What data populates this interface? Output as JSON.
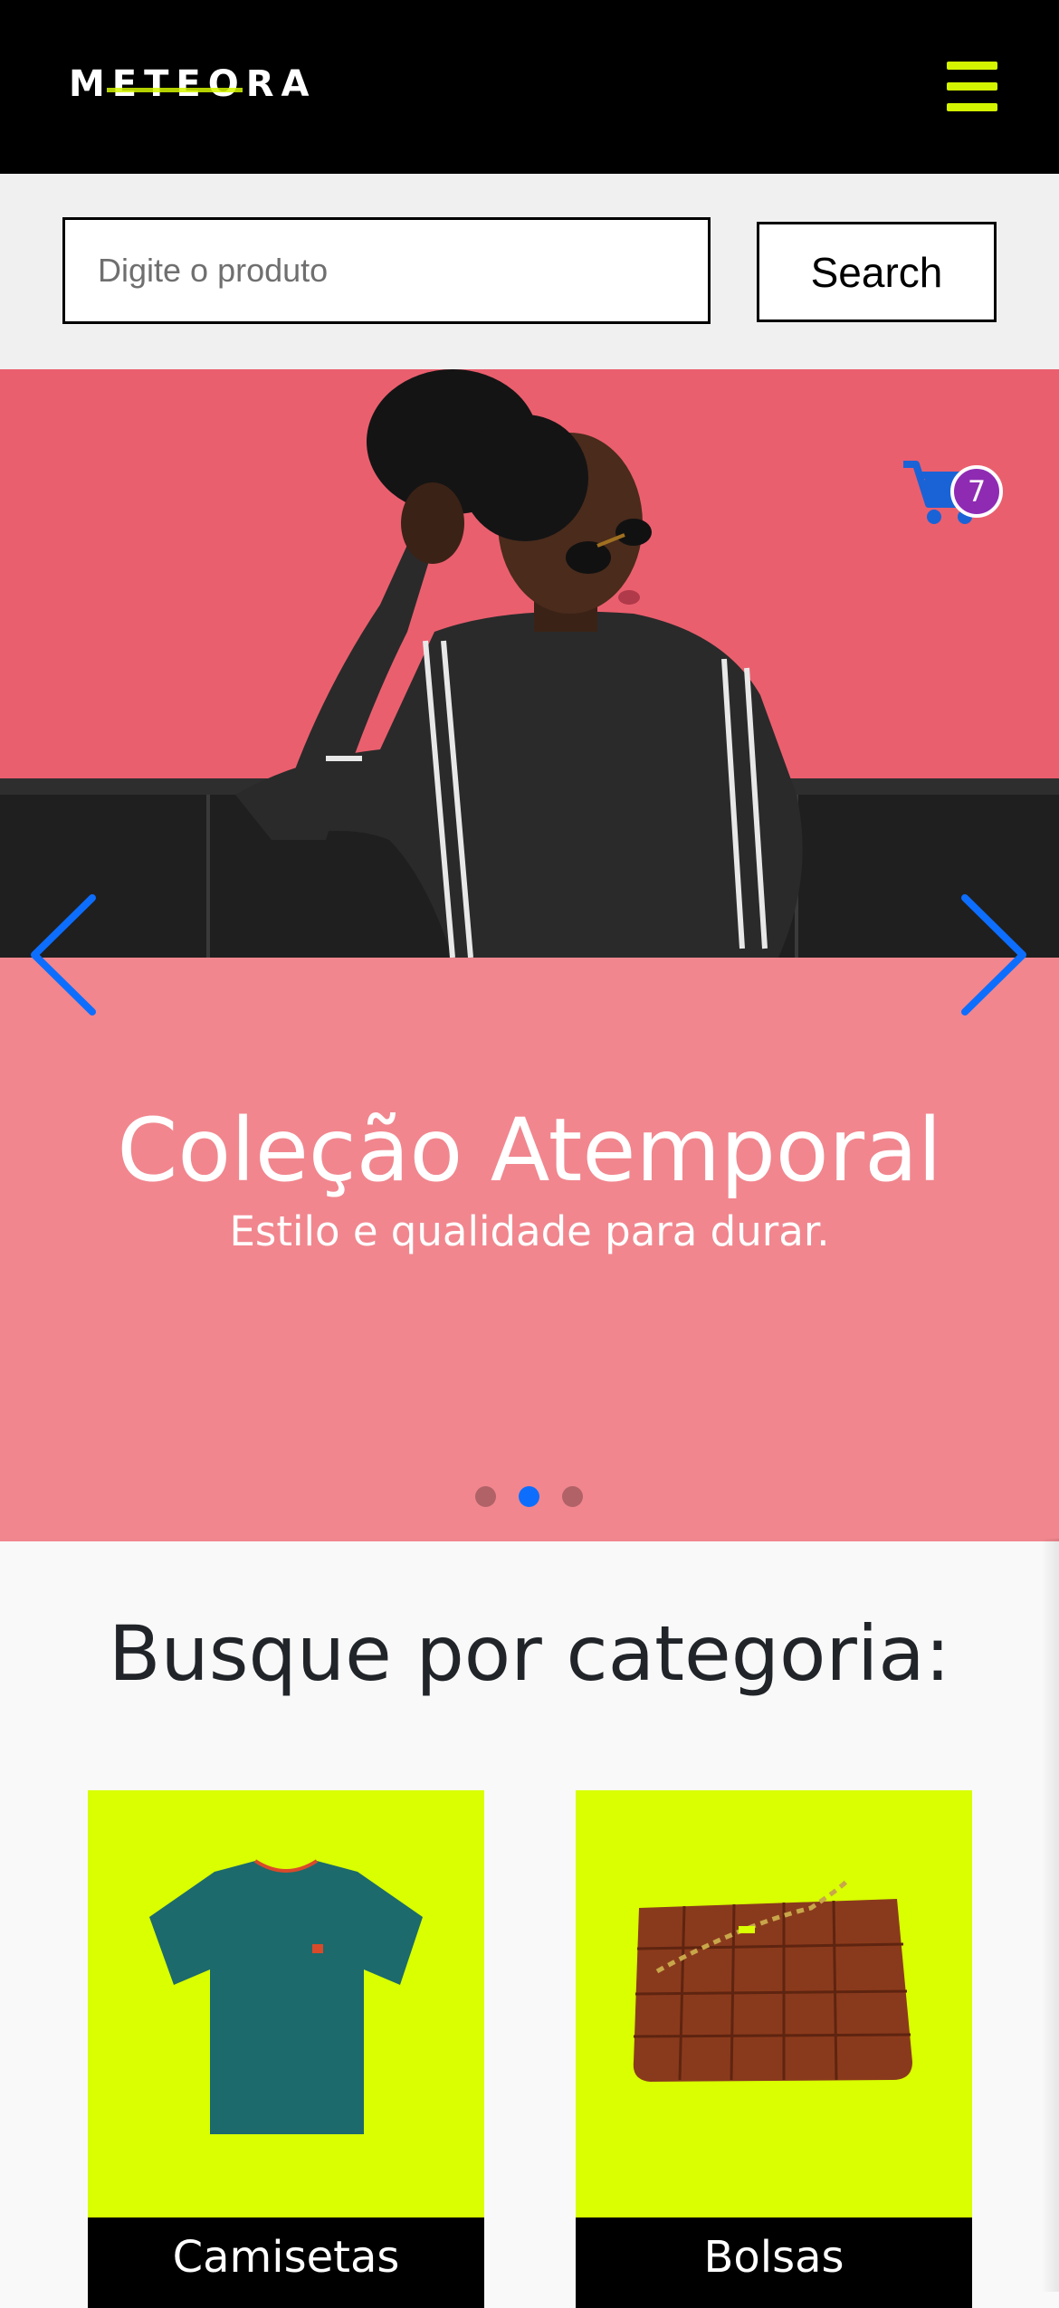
{
  "header": {
    "logo": "METEORA",
    "menu_icon": "hamburger-menu-icon",
    "accent_color": "#d4f500"
  },
  "search": {
    "placeholder": "Digite o produto",
    "value": "",
    "button_label": "Search"
  },
  "cart": {
    "icon": "shopping-cart-icon",
    "count": "7",
    "badge_color": "#8f2bb3"
  },
  "carousel": {
    "title": "Coleção Atemporal",
    "subtitle": "Estilo e qualidade para durar.",
    "prev_icon": "chevron-left-icon",
    "next_icon": "chevron-right-icon",
    "slide_count": 3,
    "active_slide": 2,
    "control_color": "#0d6efd",
    "photo_alt": "Mulher de óculos escuros sentada em sofá preto diante de parede rosa"
  },
  "categories": {
    "title": "Busque por categoria:",
    "items": [
      {
        "label": "Camisetas",
        "image": "teal-tshirt-image"
      },
      {
        "label": "Bolsas",
        "image": "brown-woven-bag-image"
      }
    ],
    "card_bg": "#d9ff00"
  }
}
